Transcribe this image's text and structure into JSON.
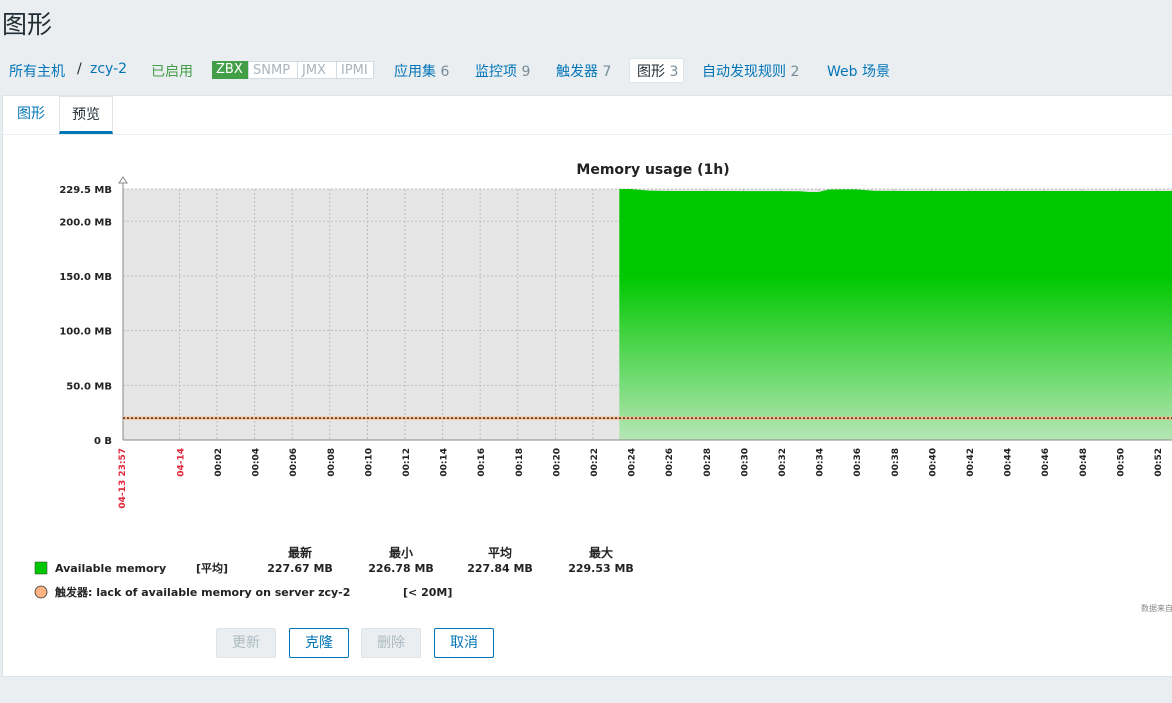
{
  "page": {
    "title": "图形"
  },
  "nav": {
    "all_hosts": "所有主机",
    "separator": "/",
    "host": "zcy-2",
    "status": "已启用",
    "tags": [
      "ZBX",
      "SNMP",
      "JMX",
      "IPMI"
    ],
    "applications": {
      "label": "应用集",
      "count": "6"
    },
    "items": {
      "label": "监控项",
      "count": "9"
    },
    "triggers": {
      "label": "触发器",
      "count": "7"
    },
    "graphs": {
      "label": "图形",
      "count": "3"
    },
    "discovery": {
      "label": "自动发现规则",
      "count": "2"
    },
    "web": {
      "label": "Web 场景"
    }
  },
  "tabs": {
    "graph": "图形",
    "preview": "预览"
  },
  "buttons": {
    "update": "更新",
    "clone": "克隆",
    "delete": "删除",
    "cancel": "取消"
  },
  "colors": {
    "series": "#00c800",
    "trigger": "#ffb380",
    "link": "#0275b8",
    "enabled": "#429e47",
    "red_label": "#e0263b"
  },
  "chart_data": {
    "type": "area",
    "title": "Memory usage (1h)",
    "y_unit": "MB",
    "ylim": [
      0,
      229.5
    ],
    "y_ticks": [
      {
        "value": 229.5,
        "label": "229.5 MB"
      },
      {
        "value": 200.0,
        "label": "200.0 MB"
      },
      {
        "value": 150.0,
        "label": "150.0 MB"
      },
      {
        "value": 100.0,
        "label": "100.0 MB"
      },
      {
        "value": 50.0,
        "label": "50.0 MB"
      },
      {
        "value": 0,
        "label": "0 B"
      }
    ],
    "x_start_label": "04-13 23:57",
    "x_ticks": [
      "04-14",
      "00:02",
      "00:04",
      "00:06",
      "00:08",
      "00:10",
      "00:12",
      "00:14",
      "00:16",
      "00:18",
      "00:20",
      "00:22",
      "00:24",
      "00:26",
      "00:28",
      "00:30",
      "00:32",
      "00:34",
      "00:36",
      "00:38",
      "00:40",
      "00:42",
      "00:44",
      "00:46",
      "00:48",
      "00:50",
      "00:52"
    ],
    "x_red_ticks": [
      "04-13 23:57",
      "04-14"
    ],
    "series": [
      {
        "name": "Available memory",
        "func": "[平均]",
        "last": "227.67 MB",
        "min": "226.78 MB",
        "avg": "227.84 MB",
        "max": "229.53 MB",
        "data_minutes": [
          26.4,
          27.0,
          28.0,
          29.0,
          30.0,
          31.0,
          32.0,
          33.0,
          34.0,
          35.0,
          36.0,
          36.5,
          37.0,
          37.5,
          38.0,
          39.0,
          40.0,
          42.0,
          44.0,
          46.0,
          48.0,
          50.0,
          52.0,
          54.0,
          56.0,
          58.5
        ],
        "values": [
          229.5,
          229.5,
          228.0,
          227.7,
          227.7,
          227.7,
          227.7,
          227.6,
          227.6,
          227.6,
          227.4,
          226.8,
          226.8,
          228.9,
          229.1,
          229.1,
          227.8,
          227.7,
          227.7,
          227.7,
          227.7,
          227.7,
          227.7,
          227.7,
          227.7,
          227.7
        ]
      }
    ],
    "legend_headers": [
      "最新",
      "最小",
      "平均",
      "最大"
    ],
    "trigger": {
      "label": "触发器: lack of available memory on server zcy-2",
      "threshold_label": "[< 20M]",
      "value": 20
    },
    "watermark": "数据来自"
  }
}
